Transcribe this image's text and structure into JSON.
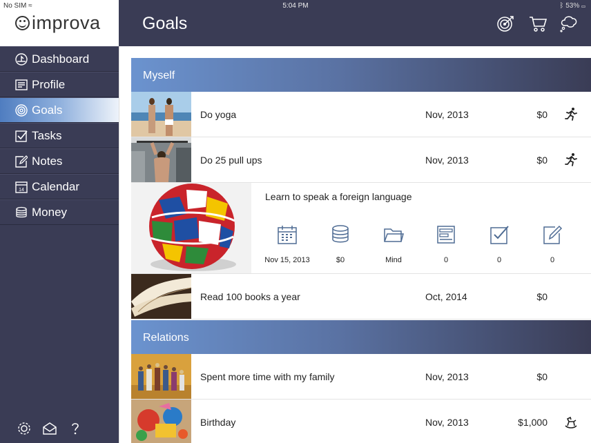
{
  "status_bar": {
    "carrier": "No SIM",
    "time": "5:04 PM",
    "battery": "53%"
  },
  "app": {
    "name": "improva"
  },
  "sidebar": {
    "items": [
      {
        "label": "Dashboard",
        "icon": "dashboard-icon"
      },
      {
        "label": "Profile",
        "icon": "profile-icon"
      },
      {
        "label": "Goals",
        "icon": "goals-icon",
        "active": true
      },
      {
        "label": "Tasks",
        "icon": "tasks-icon"
      },
      {
        "label": "Notes",
        "icon": "notes-icon"
      },
      {
        "label": "Calendar",
        "icon": "calendar-icon",
        "calendar_day": "14"
      },
      {
        "label": "Money",
        "icon": "money-icon"
      }
    ],
    "footer_icons": [
      "settings-icon",
      "mail-icon",
      "help-icon"
    ]
  },
  "header": {
    "title": "Goals",
    "icons": [
      "target-icon",
      "cart-icon",
      "thought-bubble-icon"
    ]
  },
  "sections": [
    {
      "title": "Myself",
      "goals": [
        {
          "title": "Do yoga",
          "date": "Nov, 2013",
          "money": "$0",
          "status_icon": "running-icon"
        },
        {
          "title": "Do 25 pull ups",
          "date": "Nov, 2013",
          "money": "$0",
          "status_icon": "running-icon"
        },
        {
          "title": "Learn to speak a foreign language",
          "expanded": true,
          "details": [
            {
              "icon": "calendar-icon",
              "value": "Nov 15, 2013"
            },
            {
              "icon": "coins-icon",
              "value": "$0"
            },
            {
              "icon": "folder-icon",
              "value": "Mind"
            },
            {
              "icon": "profile-icon",
              "value": "0"
            },
            {
              "icon": "tasks-icon",
              "value": "0"
            },
            {
              "icon": "notes-icon",
              "value": "0"
            }
          ]
        },
        {
          "title": "Read 100 books a year",
          "date": "Oct, 2014",
          "money": "$0",
          "status_icon": ""
        }
      ]
    },
    {
      "title": "Relations",
      "goals": [
        {
          "title": "Spent more time with my family",
          "date": "Nov, 2013",
          "money": "$0",
          "status_icon": ""
        },
        {
          "title": "Birthday",
          "date": "Nov, 2013",
          "money": "$1,000",
          "status_icon": "rocking-horse-icon"
        }
      ]
    }
  ],
  "colors": {
    "sidebar_bg": "#3a3c55",
    "accent": "#6b93cf",
    "icon_blue": "#4e6b93"
  }
}
